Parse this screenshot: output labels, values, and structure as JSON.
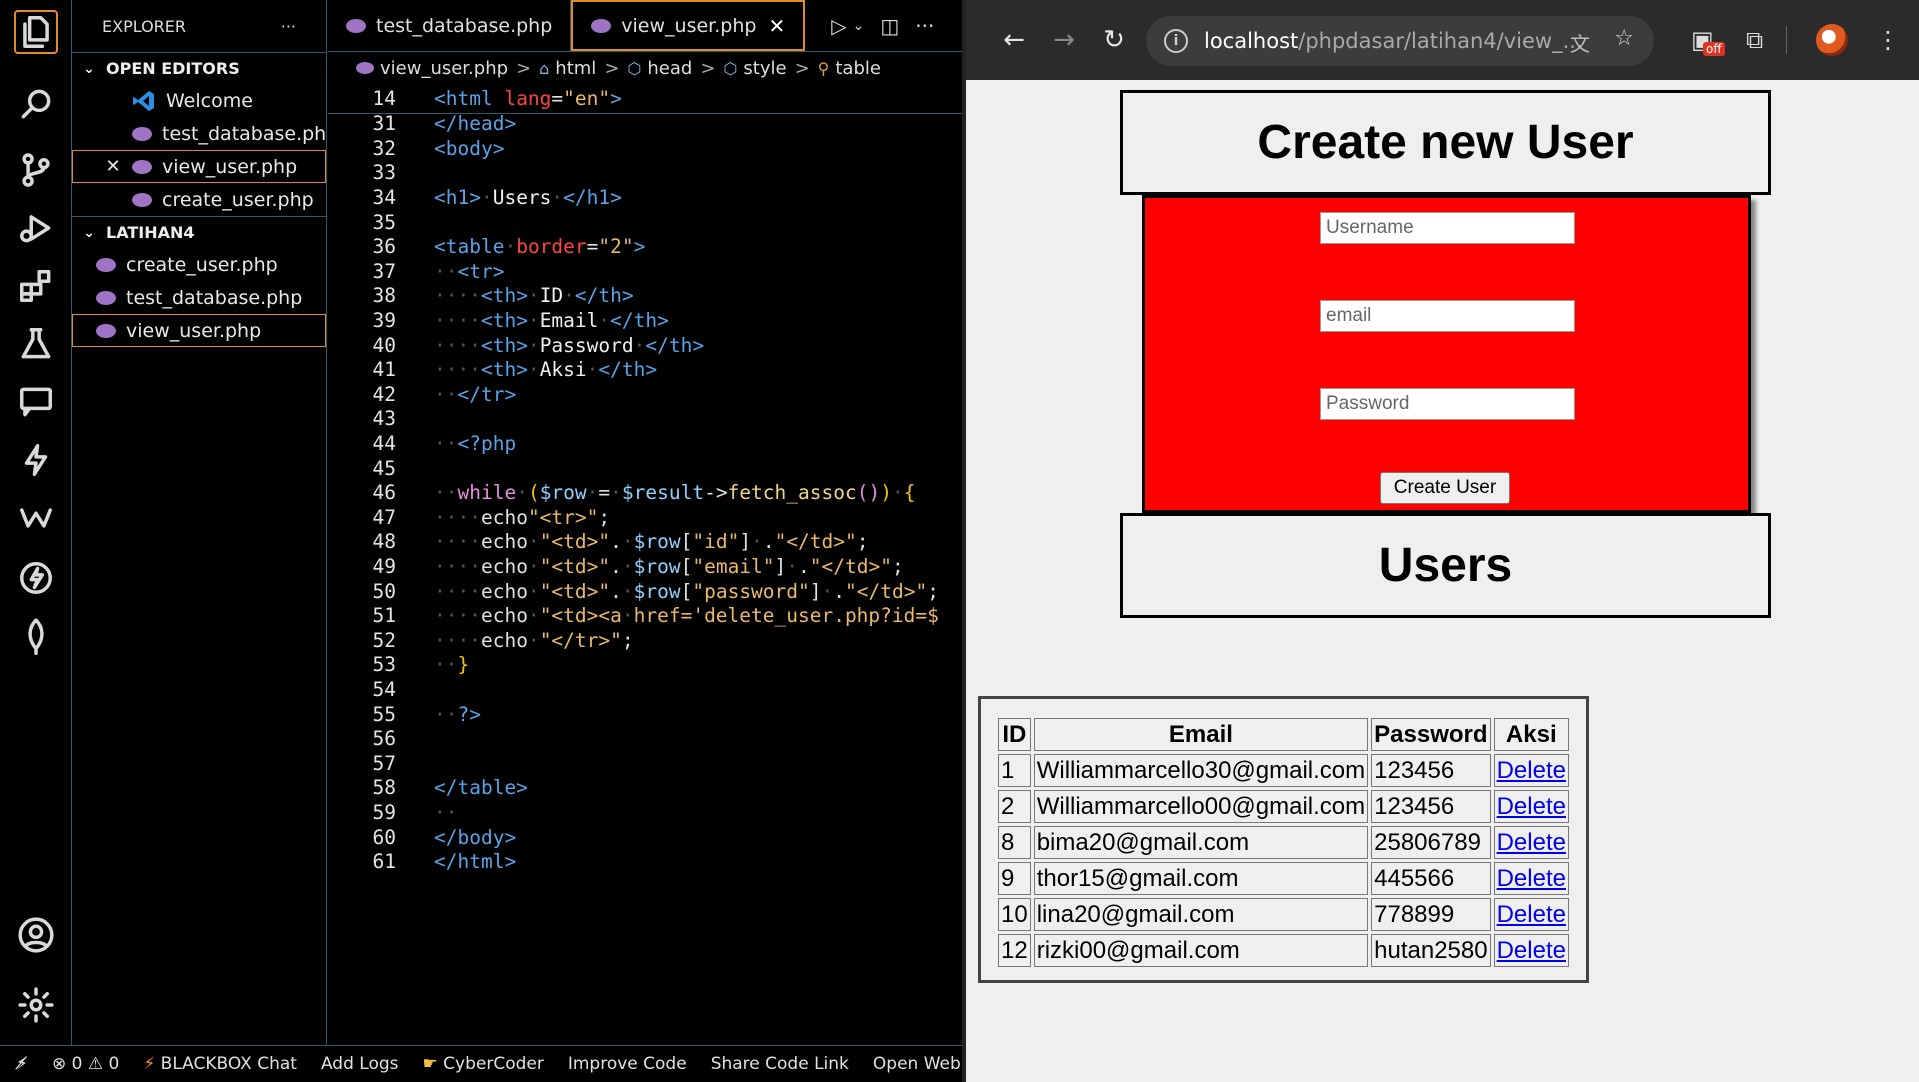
{
  "explorer": {
    "title": "EXPLORER",
    "more_label": "···",
    "open_editors_label": "OPEN EDITORS",
    "open_editors": [
      {
        "label": "Welcome",
        "icon": "vscode-icon"
      },
      {
        "label": "test_database.php",
        "icon": "php-icon"
      },
      {
        "label": "view_user.php",
        "icon": "php-icon",
        "close": "✕"
      },
      {
        "label": "create_user.php",
        "icon": "php-icon"
      }
    ],
    "folder_label": "LATIHAN4",
    "folder_files": [
      {
        "label": "create_user.php"
      },
      {
        "label": "test_database.php"
      },
      {
        "label": "view_user.php"
      }
    ]
  },
  "tabs": [
    {
      "label": "test_database.php"
    },
    {
      "label": "view_user.php",
      "close": "✕"
    }
  ],
  "breadcrumb": {
    "items": [
      "view_user.php",
      "html",
      "head",
      "style",
      "table"
    ],
    "sep": ">"
  },
  "code_lines": [
    {
      "n": "14",
      "html": "<span class='t-tag'>&lt;html</span> <span class='t-attr'>lang</span>=<span class='t-str'>\"en\"</span><span class='t-tag'>&gt;</span>"
    },
    {
      "n": "31",
      "html": "<span class='t-tag'>&lt;/head&gt;</span>"
    },
    {
      "n": "32",
      "html": "<span class='t-tag'>&lt;body&gt;</span>"
    },
    {
      "n": "33",
      "html": ""
    },
    {
      "n": "34",
      "html": "<span class='t-tag'>&lt;h1&gt;</span><span class='dot'>·</span><span class='t-txt'>Users</span><span class='dot'>·</span><span class='t-tag'>&lt;/h1&gt;</span>"
    },
    {
      "n": "35",
      "html": ""
    },
    {
      "n": "36",
      "html": "<span class='t-tag'>&lt;table</span><span class='dot'>·</span><span class='t-attr'>border</span>=<span class='t-str'>\"2\"</span><span class='t-tag'>&gt;</span>"
    },
    {
      "n": "37",
      "html": "<span class='dot'>··</span><span class='t-tag'>&lt;tr&gt;</span>"
    },
    {
      "n": "38",
      "html": "<span class='dot'>····</span><span class='t-tag'>&lt;th&gt;</span><span class='dot'>·</span><span class='t-txt'>ID</span><span class='dot'>·</span><span class='t-tag'>&lt;/th&gt;</span>"
    },
    {
      "n": "39",
      "html": "<span class='dot'>····</span><span class='t-tag'>&lt;th&gt;</span><span class='dot'>·</span><span class='t-txt'>Email</span><span class='dot'>·</span><span class='t-tag'>&lt;/th&gt;</span>"
    },
    {
      "n": "40",
      "html": "<span class='dot'>····</span><span class='t-tag'>&lt;th&gt;</span><span class='dot'>·</span><span class='t-txt'>Password</span><span class='dot'>·</span><span class='t-tag'>&lt;/th&gt;</span>"
    },
    {
      "n": "41",
      "html": "<span class='dot'>····</span><span class='t-tag'>&lt;th&gt;</span><span class='dot'>·</span><span class='t-txt'>Aksi</span><span class='dot'>·</span><span class='t-tag'>&lt;/th&gt;</span>"
    },
    {
      "n": "42",
      "html": "<span class='dot'>··</span><span class='t-tag'>&lt;/tr&gt;</span>"
    },
    {
      "n": "43",
      "html": ""
    },
    {
      "n": "44",
      "html": "<span class='dot'>··</span><span class='t-tag'>&lt;?php</span>"
    },
    {
      "n": "45",
      "html": ""
    },
    {
      "n": "46",
      "html": "<span class='dot'>··</span><span class='t-kw'>while</span><span class='dot'>·</span><span class='t-brace'>(</span><span class='t-var'>$row</span><span class='dot'>·</span>=<span class='dot'>·</span><span class='t-var'>$result</span>-&gt;<span class='t-fn'>fetch_assoc</span><span class='t-kw'>()</span><span class='t-brace'>)</span><span class='dot'>·</span><span class='t-brace'>{</span>"
    },
    {
      "n": "47",
      "html": "<span class='dot'>····</span>echo<span class='t-str'>\"&lt;tr&gt;\"</span>;"
    },
    {
      "n": "48",
      "html": "<span class='dot'>····</span>echo<span class='dot'>·</span><span class='t-str'>\"&lt;td&gt;\"</span>.<span class='dot'>·</span><span class='t-var'>$row</span>[<span class='t-str'>\"id\"</span>]<span class='dot'>·</span>.<span class='t-str'>\"&lt;/td&gt;\"</span>;"
    },
    {
      "n": "49",
      "html": "<span class='dot'>····</span>echo<span class='dot'>·</span><span class='t-str'>\"&lt;td&gt;\"</span>.<span class='dot'>·</span><span class='t-var'>$row</span>[<span class='t-str'>\"email\"</span>]<span class='dot'>·</span>.<span class='t-str'>\"&lt;/td&gt;\"</span>;"
    },
    {
      "n": "50",
      "html": "<span class='dot'>····</span>echo<span class='dot'>·</span><span class='t-str'>\"&lt;td&gt;\"</span>.<span class='dot'>·</span><span class='t-var'>$row</span>[<span class='t-str'>\"password\"</span>]<span class='dot'>·</span>.<span class='t-str'>\"&lt;/td&gt;\"</span>;"
    },
    {
      "n": "51",
      "html": "<span class='dot'>····</span>echo<span class='dot'>·</span><span class='t-str'>\"&lt;td&gt;&lt;a</span><span class='dot'>·</span><span class='t-str'>href='delete_user.php?id=$</span>"
    },
    {
      "n": "52",
      "html": "<span class='dot'>····</span>echo<span class='dot'>·</span><span class='t-str'>\"&lt;/tr&gt;\"</span>;"
    },
    {
      "n": "53",
      "html": "<span class='dot'>··</span><span class='t-brace'>}</span>"
    },
    {
      "n": "54",
      "html": ""
    },
    {
      "n": "55",
      "html": "<span class='dot'>··</span><span class='t-tag'>?&gt;</span>"
    },
    {
      "n": "56",
      "html": ""
    },
    {
      "n": "57",
      "html": ""
    },
    {
      "n": "58",
      "html": "<span class='t-tag'>&lt;/table&gt;</span>"
    },
    {
      "n": "59",
      "html": "<span class='dot'>··</span>"
    },
    {
      "n": "60",
      "html": "<span class='t-tag'>&lt;/body&gt;</span>"
    },
    {
      "n": "61",
      "html": "<span class='t-tag'>&lt;/html&gt;</span>"
    }
  ],
  "status_bar": {
    "errors": "0",
    "warnings": "0",
    "items": [
      "BLACKBOX Chat",
      "Add Logs",
      "CyberCoder",
      "Improve Code",
      "Share Code Link",
      "Open Web"
    ]
  },
  "browser": {
    "url_host": "localhost",
    "url_path": "/phpdasar/latihan4/view_...",
    "extension_badge": "off"
  },
  "page": {
    "create_title": "Create new User",
    "username_placeholder": "Username",
    "email_placeholder": "email",
    "password_placeholder": "Password",
    "create_button": "Create User",
    "users_title": "Users",
    "table_headers": [
      "ID",
      "Email",
      "Password",
      "Aksi"
    ],
    "rows": [
      {
        "id": "1",
        "email": "Williammarcello30@gmail.com",
        "password": "123456",
        "action": "Delete"
      },
      {
        "id": "2",
        "email": "Williammarcello00@gmail.com",
        "password": "123456",
        "action": "Delete"
      },
      {
        "id": "8",
        "email": "bima20@gmail.com",
        "password": "25806789",
        "action": "Delete"
      },
      {
        "id": "9",
        "email": "thor15@gmail.com",
        "password": "445566",
        "action": "Delete"
      },
      {
        "id": "10",
        "email": "lina20@gmail.com",
        "password": "778899",
        "action": "Delete"
      },
      {
        "id": "12",
        "email": "rizki00@gmail.com",
        "password": "hutan2580",
        "action": "Delete"
      }
    ]
  },
  "colors": {
    "accent": "#e08a2c",
    "form_bg": "#ff0000",
    "link": "#0000ee"
  }
}
